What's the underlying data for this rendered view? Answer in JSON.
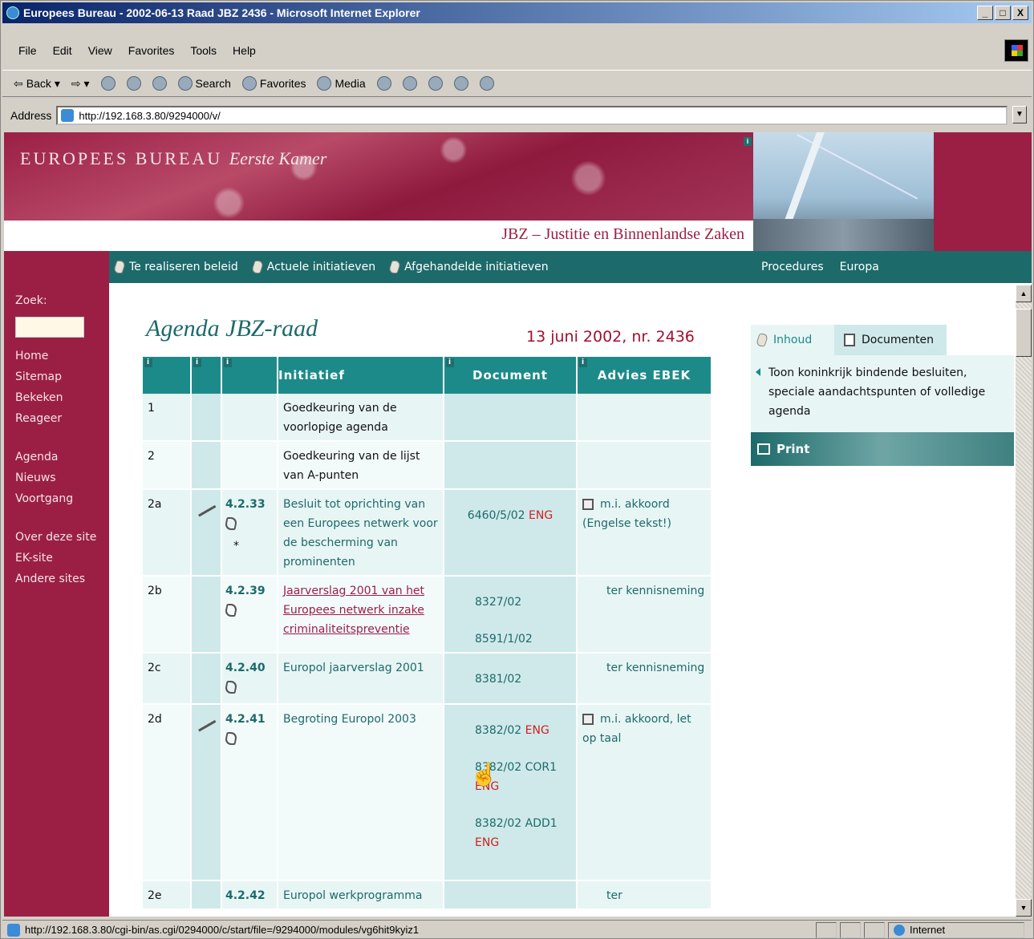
{
  "window": {
    "title": "Europees Bureau - 2002-06-13 Raad JBZ 2436 - Microsoft Internet Explorer",
    "min": "_",
    "max": "□",
    "close": "X"
  },
  "menu": [
    "File",
    "Edit",
    "View",
    "Favorites",
    "Tools",
    "Help"
  ],
  "toolbar": {
    "back": "Back",
    "search": "Search",
    "favorites": "Favorites",
    "media": "Media"
  },
  "address": {
    "label": "Address",
    "url": "http://192.168.3.80/9294000/v/"
  },
  "banner": {
    "title": "EUROPEES BUREAU",
    "title_italic": "Eerste Kamer",
    "subtitle": "JBZ – Justitie en Binnenlandse Zaken"
  },
  "topnav": [
    "Te realiseren beleid",
    "Actuele initiatieven",
    "Afgehandelde initiatieven"
  ],
  "rightnav": [
    "Procedures",
    "Europa"
  ],
  "sidebar": {
    "search_label": "Zoek:",
    "group1": [
      "Home",
      "Sitemap",
      "Bekeken",
      "Reageer"
    ],
    "group2": [
      "Agenda",
      "Nieuws",
      "Voortgang"
    ],
    "group3": [
      "Over deze site",
      "EK-site",
      "Andere sites"
    ]
  },
  "agenda": {
    "title": "Agenda JBZ-raad",
    "date": "13 juni 2002,   nr. 2436",
    "headers": {
      "initiatief": "Initiatief",
      "document": "Document",
      "advies": "Advies EBEK"
    },
    "rows": [
      {
        "nr": "1",
        "code": "",
        "title": "Goedkeuring van de voorlopige agenda",
        "docs": "",
        "advies": ""
      },
      {
        "nr": "2",
        "code": "",
        "title": "Goedkeuring van de lijst van A-punten",
        "docs": "",
        "advies": ""
      },
      {
        "nr": "2a",
        "code": "4.2.33",
        "star": "*",
        "title": "Besluit tot oprichting van een Europees netwerk voor de bescherming van prominenten",
        "doc1": "6460/5/02",
        "doc1_eng": "ENG",
        "advies": "m.i. akkoord (Engelse tekst!)"
      },
      {
        "nr": "2b",
        "code": "4.2.39",
        "title": "Jaarverslag 2001 van het Europees netwerk inzake criminaliteitspreventie",
        "doc1": "8327/02",
        "doc2": "8591/1/02",
        "advies": "ter kennisneming"
      },
      {
        "nr": "2c",
        "code": "4.2.40",
        "title": "Europol jaarverslag 2001",
        "doc1": "8381/02",
        "advies": "ter kennisneming"
      },
      {
        "nr": "2d",
        "code": "4.2.41",
        "title": "Begroting Europol 2003",
        "doc1": "8382/02",
        "doc1_eng": "ENG",
        "doc2": "8382/02 COR1",
        "doc2_eng": "ENG",
        "doc3": "8382/02 ADD1",
        "doc3_eng": "ENG",
        "advies": "m.i. akkoord, let op taal"
      },
      {
        "nr": "2e",
        "code": "4.2.42",
        "title": "Europol werkprogramma",
        "advies": "ter"
      }
    ]
  },
  "rpanel": {
    "tab1": "Inhoud",
    "tab2": "Documenten",
    "body": "Toon koninkrijk bindende besluiten, speciale aandachtspunten of volledige agenda",
    "print": "Print"
  },
  "status": {
    "url": "http://192.168.3.80/cgi-bin/as.cgi/0294000/c/start/file=/9294000/modules/vg6hit9kyiz1",
    "zone": "Internet"
  }
}
